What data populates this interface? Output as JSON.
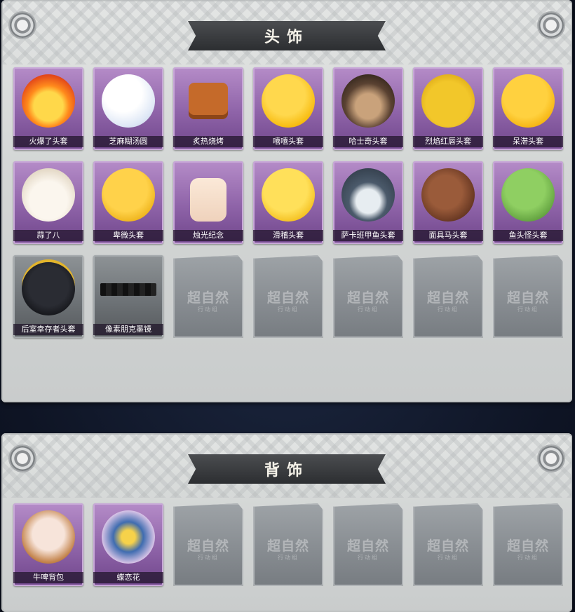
{
  "head_section": {
    "title": "头饰",
    "watermark_main": "超自然",
    "watermark_sub": "行动组",
    "items": [
      {
        "label": "火爆了头套",
        "icon": "fire-spirit-mask",
        "owned": true,
        "frame": "purple"
      },
      {
        "label": "芝麻糊汤圆",
        "icon": "white-dumpling-mask",
        "owned": true,
        "frame": "purple"
      },
      {
        "label": "炙热烧烤",
        "icon": "bbq-skewer-mask",
        "owned": true,
        "frame": "purple"
      },
      {
        "label": "嘻嘻头套",
        "icon": "grin-emoji-mask",
        "owned": true,
        "frame": "purple"
      },
      {
        "label": "哈士奇头套",
        "icon": "husky-mask",
        "owned": true,
        "frame": "purple"
      },
      {
        "label": "烈焰红唇头套",
        "icon": "yellow-mouse-mask",
        "owned": true,
        "frame": "purple"
      },
      {
        "label": "呆滞头套",
        "icon": "stunned-emoji-mask",
        "owned": true,
        "frame": "purple"
      },
      {
        "label": "蒜了八",
        "icon": "garlic-mask",
        "owned": true,
        "frame": "purple"
      },
      {
        "label": "卑微头套",
        "icon": "humble-emoji-mask",
        "owned": true,
        "frame": "purple"
      },
      {
        "label": "烛光纪念",
        "icon": "candle-mask",
        "owned": true,
        "frame": "purple"
      },
      {
        "label": "滑稽头套",
        "icon": "funny-emoji-mask",
        "owned": true,
        "frame": "purple"
      },
      {
        "label": "萨卡班甲鱼头套",
        "icon": "sacabambaspis-mask",
        "owned": true,
        "frame": "purple"
      },
      {
        "label": "面具马头套",
        "icon": "horse-mask",
        "owned": true,
        "frame": "purple"
      },
      {
        "label": "鱼头怪头套",
        "icon": "fish-head-mask",
        "owned": true,
        "frame": "purple"
      },
      {
        "label": "后室幸存者头套",
        "icon": "gas-mask-helmet",
        "owned": true,
        "frame": "grey"
      },
      {
        "label": "像素朋克墨镜",
        "icon": "pixel-sunglasses",
        "owned": true,
        "frame": "grey"
      },
      {
        "label": "",
        "icon": "empty-slot",
        "owned": false
      },
      {
        "label": "",
        "icon": "empty-slot",
        "owned": false
      },
      {
        "label": "",
        "icon": "empty-slot",
        "owned": false
      },
      {
        "label": "",
        "icon": "empty-slot",
        "owned": false
      },
      {
        "label": "",
        "icon": "empty-slot",
        "owned": false
      }
    ]
  },
  "back_section": {
    "title": "背饰",
    "items": [
      {
        "label": "牛啤背包",
        "icon": "cow-beer-backpack",
        "owned": true,
        "frame": "purple"
      },
      {
        "label": "蝶恋花",
        "icon": "butterfly-bell-ornament",
        "owned": true,
        "frame": "purple"
      },
      {
        "label": "",
        "icon": "empty-slot",
        "owned": false
      },
      {
        "label": "",
        "icon": "empty-slot",
        "owned": false
      },
      {
        "label": "",
        "icon": "empty-slot",
        "owned": false
      },
      {
        "label": "",
        "icon": "empty-slot",
        "owned": false
      },
      {
        "label": "",
        "icon": "empty-slot",
        "owned": false
      }
    ]
  }
}
